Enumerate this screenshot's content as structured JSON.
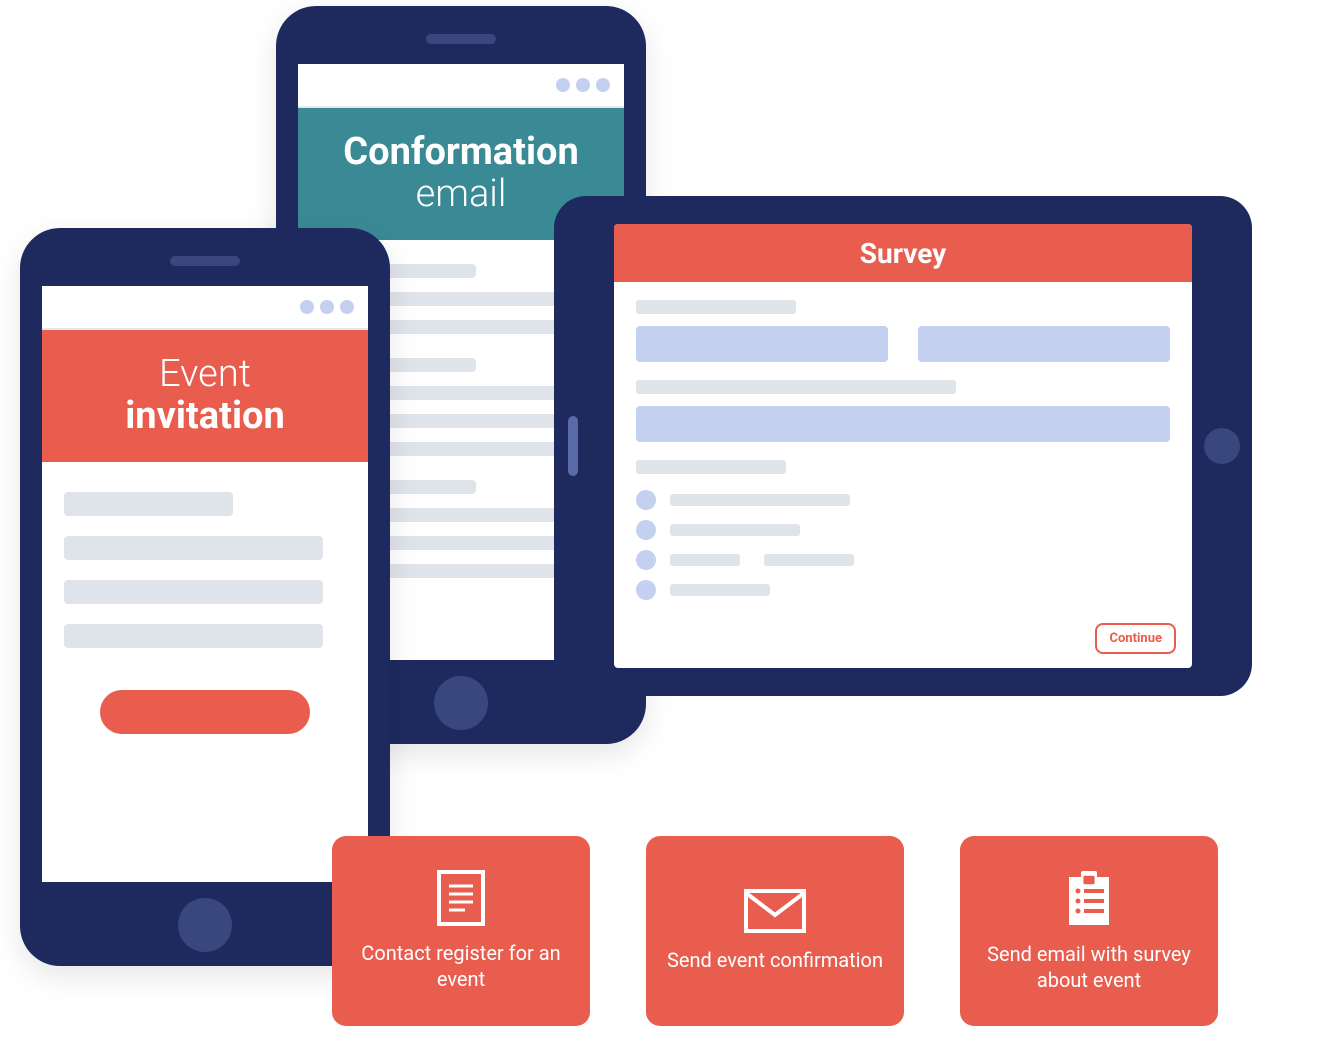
{
  "phone1": {
    "title_line1": "Event",
    "title_line2": "invitation"
  },
  "phone2": {
    "title_line1": "Conformation",
    "title_line2": "email"
  },
  "tablet": {
    "title": "Survey",
    "continue_label": "Continue"
  },
  "flow": {
    "step1": {
      "label": "Contact register for an event"
    },
    "step2": {
      "label": "Send event confirmation"
    },
    "step3": {
      "label": "Send email with survey about event"
    }
  },
  "colors": {
    "accent": "#e85d4e",
    "navy": "#1e2a5e",
    "teal": "#3a8a95",
    "light_blue": "#c3d0ef",
    "grey": "#dfe3ea"
  }
}
